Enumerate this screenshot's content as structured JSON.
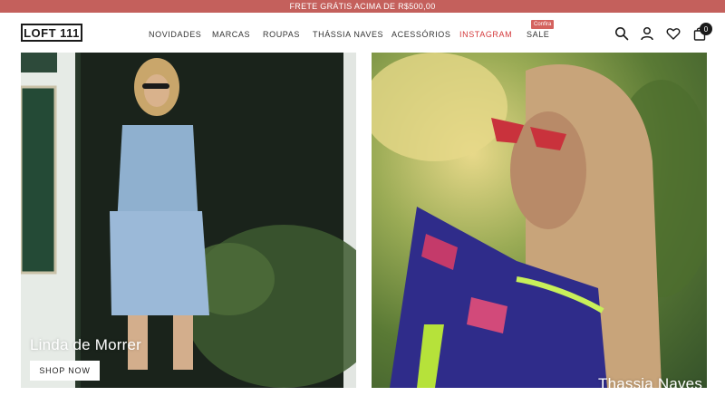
{
  "promo": {
    "text": "FRETE GRÁTIS ACIMA DE R$500,00"
  },
  "brand": {
    "logo_text": "LOFT 111"
  },
  "nav": {
    "items": [
      {
        "label": "NOVIDADES"
      },
      {
        "label": "MARCAS"
      },
      {
        "label": "ROUPAS"
      },
      {
        "label": "THÁSSIA NAVES"
      },
      {
        "label": "ACESSÓRIOS"
      },
      {
        "label": "INSTAGRAM"
      },
      {
        "label": "SALE"
      }
    ],
    "sale_badge": "Confira"
  },
  "header_icons": {
    "search": "search-icon",
    "account": "user-icon",
    "wishlist": "heart-icon",
    "cart": "bag-icon",
    "cart_count": "0"
  },
  "banners": [
    {
      "title": "Linda de Morrer",
      "cta": "SHOP NOW"
    },
    {
      "title": "Thassia Naves"
    }
  ],
  "colors": {
    "promo_bg": "#c4605c",
    "accent": "#d4383a",
    "badge": "#d4625e"
  }
}
